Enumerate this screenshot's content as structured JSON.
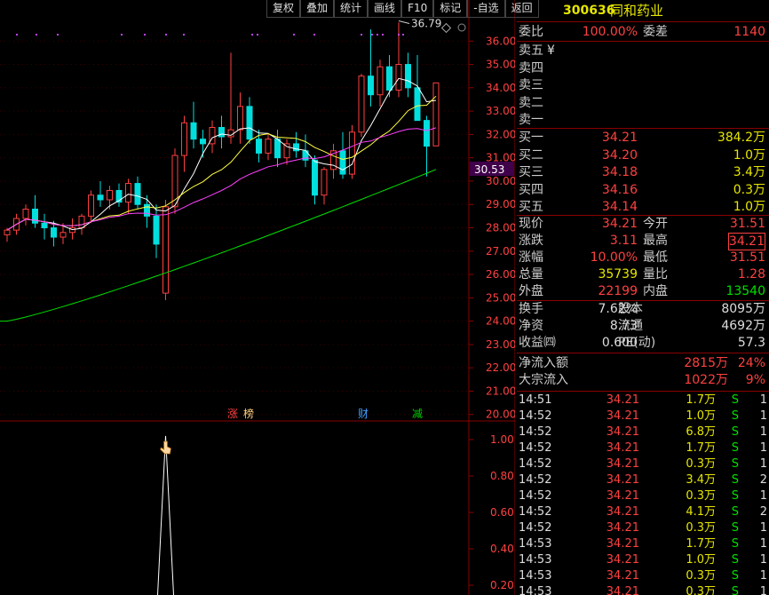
{
  "toolbar": [
    "复权",
    "叠加",
    "统计",
    "画线",
    "F10",
    "标记",
    "-自选",
    "返回"
  ],
  "stock": {
    "code": "300636",
    "name": "同和药业"
  },
  "weibi": {
    "label": "委比",
    "value": "100.00%",
    "label2": "委差",
    "value2": "1140"
  },
  "sell": [
    {
      "label": "卖五",
      "price": "¥",
      "vol": ""
    },
    {
      "label": "卖四",
      "price": "",
      "vol": ""
    },
    {
      "label": "卖三",
      "price": "",
      "vol": ""
    },
    {
      "label": "卖二",
      "price": "",
      "vol": ""
    },
    {
      "label": "卖一",
      "price": "",
      "vol": ""
    }
  ],
  "buy": [
    {
      "label": "买一",
      "price": "34.21",
      "vol": "384.2万"
    },
    {
      "label": "买二",
      "price": "34.20",
      "vol": "1.0万"
    },
    {
      "label": "买三",
      "price": "34.18",
      "vol": "3.4万"
    },
    {
      "label": "买四",
      "price": "34.16",
      "vol": "0.3万"
    },
    {
      "label": "买五",
      "price": "34.14",
      "vol": "1.0万"
    }
  ],
  "stats": [
    {
      "l1": "现价",
      "v1": "34.21",
      "l2": "今开",
      "v2": "31.51"
    },
    {
      "l1": "涨跌",
      "v1": "3.11",
      "l2": "最高",
      "v2": "34.21"
    },
    {
      "l1": "涨幅",
      "v1": "10.00%",
      "l2": "最低",
      "v2": "31.51"
    },
    {
      "l1": "总量",
      "v1": "35739",
      "l2": "量比",
      "v2": "1.28"
    },
    {
      "l1": "外盘",
      "v1": "22199",
      "l2": "内盘",
      "v2": "13540"
    }
  ],
  "stats2": [
    {
      "l1": "换手",
      "v1": "7.62%",
      "l2": "股本",
      "v2": "8095万"
    },
    {
      "l1": "净资",
      "v1": "8.73",
      "l2": "流通",
      "v2": "4692万"
    },
    {
      "l1": "收益㈣",
      "v1": "0.600",
      "l2": "PE(动)",
      "v2": "57.3"
    }
  ],
  "flows": [
    {
      "label": "净流入额",
      "value": "2815万",
      "pct": "24%"
    },
    {
      "label": "大宗流入",
      "value": "1022万",
      "pct": "9%"
    }
  ],
  "ticks": [
    {
      "time": "14:51",
      "price": "34.21",
      "vol": "1.7万",
      "bs": "S",
      "n": "1"
    },
    {
      "time": "14:52",
      "price": "34.21",
      "vol": "1.0万",
      "bs": "S",
      "n": "1"
    },
    {
      "time": "14:52",
      "price": "34.21",
      "vol": "6.8万",
      "bs": "S",
      "n": "1"
    },
    {
      "time": "14:52",
      "price": "34.21",
      "vol": "1.7万",
      "bs": "S",
      "n": "1"
    },
    {
      "time": "14:52",
      "price": "34.21",
      "vol": "0.3万",
      "bs": "S",
      "n": "1"
    },
    {
      "time": "14:52",
      "price": "34.21",
      "vol": "3.4万",
      "bs": "S",
      "n": "2"
    },
    {
      "time": "14:52",
      "price": "34.21",
      "vol": "0.3万",
      "bs": "S",
      "n": "1"
    },
    {
      "time": "14:52",
      "price": "34.21",
      "vol": "4.1万",
      "bs": "S",
      "n": "2"
    },
    {
      "time": "14:52",
      "price": "34.21",
      "vol": "0.3万",
      "bs": "S",
      "n": "1"
    },
    {
      "time": "14:53",
      "price": "34.21",
      "vol": "1.7万",
      "bs": "S",
      "n": "1"
    },
    {
      "time": "14:53",
      "price": "34.21",
      "vol": "1.0万",
      "bs": "S",
      "n": "1"
    },
    {
      "time": "14:53",
      "price": "34.21",
      "vol": "0.3万",
      "bs": "S",
      "n": "1"
    },
    {
      "time": "14:53",
      "price": "34.21",
      "vol": "0.3万",
      "bs": "S",
      "n": "1"
    }
  ],
  "chart_data": {
    "type": "candlestick",
    "price_axis_ticks": [
      "36.00",
      "35.00",
      "34.00",
      "33.00",
      "32.00",
      "31.00",
      "30.00",
      "29.00",
      "28.00",
      "27.00",
      "26.00",
      "25.00",
      "24.00",
      "23.00",
      "22.00",
      "21.00",
      "20.00"
    ],
    "ylim": [
      19.8,
      37.0
    ],
    "current_price_label": "30.53",
    "high_annotation": "36.79",
    "tags": [
      "涨",
      "榜",
      "财",
      "减"
    ],
    "lower_axis_ticks": [
      "1.00",
      "0.80",
      "0.60",
      "0.40",
      "0.20"
    ],
    "lower_ylim": [
      0.0,
      1.1
    ],
    "candles": [
      [
        27.7,
        28.0,
        27.4,
        27.9
      ],
      [
        27.9,
        28.6,
        27.7,
        28.4
      ],
      [
        28.4,
        29.0,
        28.1,
        28.8
      ],
      [
        28.8,
        29.4,
        28.0,
        28.2
      ],
      [
        28.2,
        28.6,
        27.5,
        28.0
      ],
      [
        28.0,
        28.3,
        27.2,
        27.6
      ],
      [
        27.6,
        28.2,
        27.3,
        27.8
      ],
      [
        27.8,
        28.4,
        27.5,
        28.0
      ],
      [
        28.0,
        28.6,
        27.7,
        28.5
      ],
      [
        28.5,
        29.6,
        28.2,
        29.4
      ],
      [
        29.4,
        30.0,
        28.9,
        29.2
      ],
      [
        29.2,
        29.8,
        28.8,
        29.6
      ],
      [
        29.6,
        29.9,
        28.9,
        29.1
      ],
      [
        29.1,
        30.1,
        28.6,
        29.9
      ],
      [
        29.9,
        30.2,
        28.8,
        29.0
      ],
      [
        29.0,
        29.4,
        28.0,
        28.5
      ],
      [
        28.5,
        29.0,
        26.7,
        27.3
      ],
      [
        25.2,
        29.2,
        24.9,
        28.9
      ],
      [
        28.9,
        31.4,
        28.6,
        31.1
      ],
      [
        31.1,
        32.8,
        30.4,
        32.5
      ],
      [
        32.5,
        33.4,
        31.4,
        31.8
      ],
      [
        31.8,
        32.2,
        31.0,
        31.6
      ],
      [
        31.6,
        32.6,
        31.2,
        32.3
      ],
      [
        32.3,
        32.8,
        31.4,
        31.9
      ],
      [
        31.9,
        35.5,
        31.6,
        32.2
      ],
      [
        32.2,
        33.8,
        31.6,
        33.2
      ],
      [
        33.2,
        33.6,
        31.6,
        31.8
      ],
      [
        31.8,
        32.2,
        30.8,
        31.2
      ],
      [
        31.2,
        32.0,
        30.9,
        31.8
      ],
      [
        31.8,
        32.2,
        30.6,
        31.0
      ],
      [
        31.0,
        31.8,
        30.7,
        31.6
      ],
      [
        31.6,
        32.1,
        31.0,
        31.3
      ],
      [
        31.3,
        32.0,
        30.6,
        30.9
      ],
      [
        30.9,
        31.1,
        29.0,
        29.4
      ],
      [
        29.4,
        30.6,
        29.0,
        30.5
      ],
      [
        30.5,
        31.6,
        30.1,
        31.3
      ],
      [
        31.3,
        32.1,
        30.1,
        30.3
      ],
      [
        30.3,
        32.4,
        30.1,
        32.1
      ],
      [
        32.1,
        34.6,
        31.9,
        34.5
      ],
      [
        34.5,
        36.5,
        33.2,
        33.7
      ],
      [
        33.7,
        35.2,
        33.2,
        34.9
      ],
      [
        34.9,
        35.4,
        33.6,
        33.9
      ],
      [
        33.9,
        36.8,
        33.6,
        35.0
      ],
      [
        35.0,
        35.5,
        33.6,
        34.0
      ],
      [
        34.0,
        35.4,
        32.8,
        32.6
      ],
      [
        32.6,
        32.8,
        30.2,
        31.5
      ],
      [
        31.51,
        34.21,
        31.51,
        34.21
      ]
    ]
  }
}
